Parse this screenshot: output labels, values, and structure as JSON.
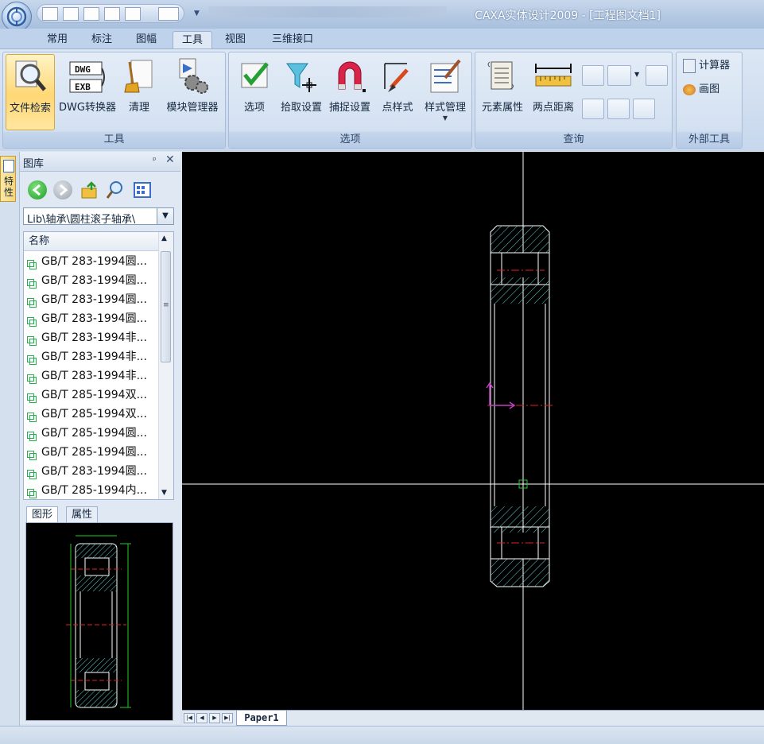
{
  "window": {
    "title": "CAXA实体设计2009 - [工程图文档1]"
  },
  "ribbon_tabs": [
    "常用",
    "标注",
    "图幅",
    "工具",
    "视图",
    "三维接口"
  ],
  "active_tab": "工具",
  "ribbon": {
    "groups": [
      {
        "label": "工具",
        "buttons": [
          "文件检索",
          "DWG转换器",
          "清理",
          "模块管理器"
        ]
      },
      {
        "label": "选项",
        "buttons": [
          "选项",
          "拾取设置",
          "捕捉设置",
          "点样式",
          "样式管理"
        ]
      },
      {
        "label": "查询",
        "buttons": [
          "元素属性",
          "两点距离"
        ]
      },
      {
        "label": "外部工具",
        "buttons": [
          "计算器",
          "画图"
        ]
      }
    ],
    "selected_button": "文件检索",
    "dwg_icon_text": [
      "DWG",
      "EXB"
    ]
  },
  "side_tab": "特性",
  "library": {
    "title": "图库",
    "path": "Lib\\轴承\\圆柱滚子轴承\\",
    "column_header": "名称",
    "items": [
      "GB/T 283-1994圆...",
      "GB/T 283-1994圆...",
      "GB/T 283-1994圆...",
      "GB/T 283-1994圆...",
      "GB/T 283-1994非...",
      "GB/T 283-1994非...",
      "GB/T 283-1994非...",
      "GB/T 285-1994双...",
      "GB/T 285-1994双...",
      "GB/T 285-1994圆...",
      "GB/T 285-1994圆...",
      "GB/T 283-1994圆...",
      "GB/T 285-1994内..."
    ],
    "preview_tabs": [
      "图形",
      "属性"
    ]
  },
  "sheet_tab": "Paper1",
  "colors": {
    "canvas_bg": "#000000",
    "hatch": "#5fd0c8",
    "outline": "#ffffff",
    "centerline": "#e02020",
    "dimension": "#22cc22",
    "axis_marker": "#c040c0"
  }
}
